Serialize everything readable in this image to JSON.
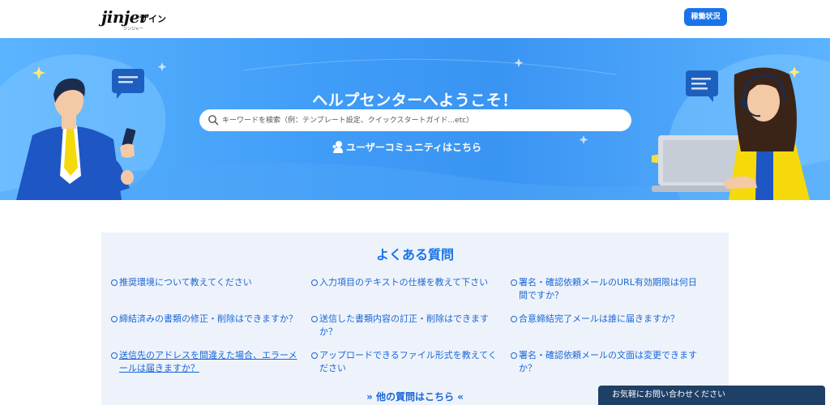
{
  "header": {
    "logo_brand": "jinjer",
    "logo_product": "サイン",
    "logo_kana": "ジンジャー",
    "status_button": "稼働状況"
  },
  "hero": {
    "title": "ヘルプセンターへようこそ！",
    "search_placeholder": "キーワードを検索（例：テンプレート設定、クイックスタートガイド...etc）",
    "community_link": "ユーザーコミュニティはこちら"
  },
  "faq": {
    "title": "よくある質問",
    "items": [
      {
        "label": "推奨環境について教えてください",
        "visited": false
      },
      {
        "label": "入力項目のテキストの仕様を教えて下さい",
        "visited": false
      },
      {
        "label": "署名・確認依頼メールのURL有効期限は何日間ですか？",
        "visited": false
      },
      {
        "label": "締結済みの書類の修正・削除はできますか？",
        "visited": false
      },
      {
        "label": "送信した書類内容の訂正・削除はできますか？",
        "visited": false
      },
      {
        "label": "合意締結完了メールは誰に届きますか？",
        "visited": false
      },
      {
        "label": "送信先のアドレスを間違えた場合、エラーメールは届きますか？",
        "visited": true
      },
      {
        "label": "アップロードできるファイル形式を教えてください",
        "visited": false
      },
      {
        "label": "署名・確認依頼メールの文面は変更できますか？",
        "visited": false
      }
    ],
    "more_link": "»  他の質問はこちら  «"
  },
  "contact_bar": "お気軽にお問い合わせください",
  "colors": {
    "accent": "#1a73e8",
    "hero_blue": "#3f9cf7",
    "faq_bg": "#eef3fb",
    "contact_bg": "#1e3f66"
  }
}
